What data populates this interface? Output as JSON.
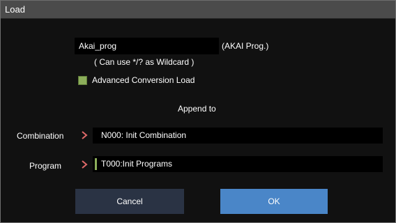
{
  "dialog": {
    "title": "Load",
    "filename": "Akai_prog",
    "filetype": "(AKAI Prog.)",
    "wildcard_hint": "( Can use */? as Wildcard )",
    "checkbox_label": "Advanced Conversion Load",
    "checkbox_checked": true,
    "append_label": "Append to",
    "combination_label": "Combination",
    "combination_value": "N000: Init Combination",
    "program_label": "Program",
    "program_value": "T000:Init Programs",
    "cancel_label": "Cancel",
    "ok_label": "OK"
  },
  "colors": {
    "accent_green": "#8cae5a",
    "ok_blue": "#4a86c8",
    "arrow_red": "#e06a6a"
  },
  "icons": {
    "arrow": "chevron-right-icon"
  }
}
